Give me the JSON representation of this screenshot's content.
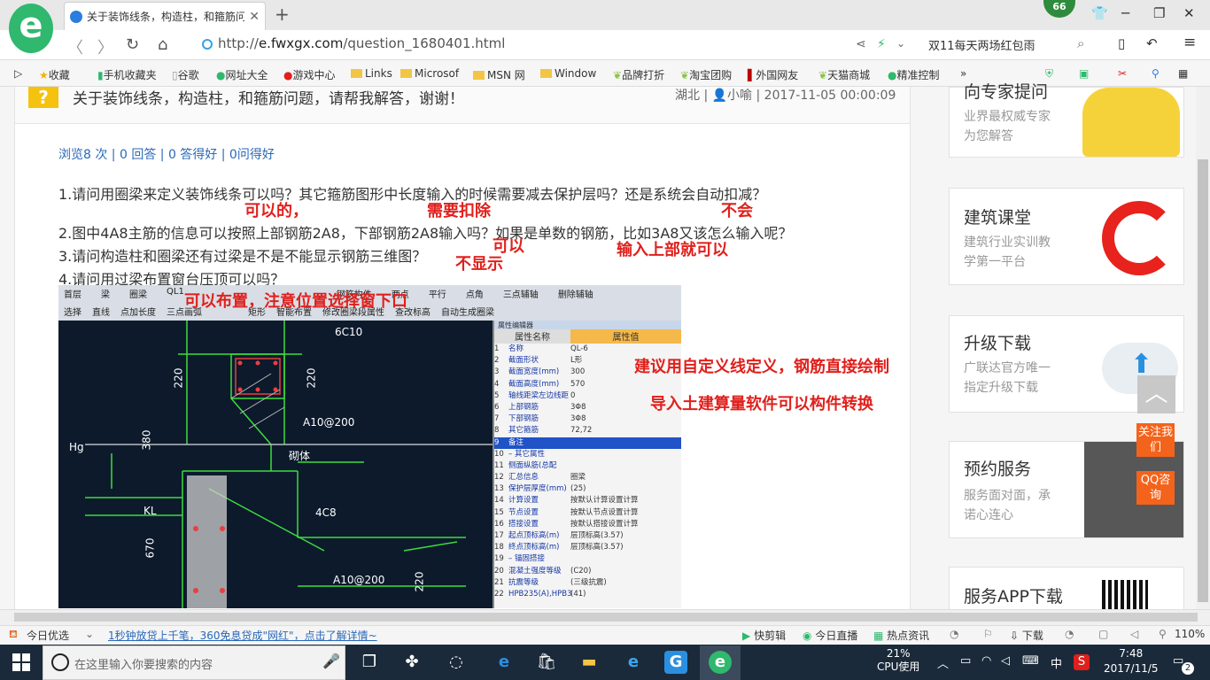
{
  "browser": {
    "tab_title": "关于装饰线条，构造柱，和箍筋问",
    "new_tab": "+",
    "badge": "66",
    "url_prefix": "http://",
    "url_domain": "e.fwxgx.com",
    "url_path": "/question_1680401.html",
    "search_text": "双11每天两场红包雨",
    "zoom": "110%"
  },
  "bookmarks": [
    "收藏",
    "手机收藏夹",
    "谷歌",
    "网址大全",
    "游戏中心",
    "Links",
    "Microsof",
    "MSN 网",
    "Window",
    "品牌打折",
    "淘宝团购",
    "外国网友",
    "天猫商城",
    "精准控制"
  ],
  "question": {
    "title": "关于装饰线条，构造柱，和箍筋问题，请帮我解答，谢谢！",
    "meta": "湖北 | 👤小喻 | 2017-11-05 00:00:09",
    "stats": "浏览8 次 | 0 回答 | 0 答得好 | 0问得好",
    "lines": [
      "1.请问用圈梁来定义装饰线条可以吗？其它箍筋图形中长度输入的时候需要减去保护层吗？还是系统会自动扣减？",
      "2.图中4A8主筋的信息可以按照上部钢筋2A8，下部钢筋2A8输入吗？如果是单数的钢筋，比如3A8又该怎么输入呢？",
      "3.请问构造柱和圈梁还有过梁是不是不能显示钢筋三维图？",
      "4.请问用过梁布置窗台压顶可以吗？"
    ],
    "annotations": {
      "a1": "可以的，",
      "a2": "需要扣除",
      "a3": "不会",
      "a4": "可以",
      "a5": "输入上部就可以",
      "a6": "不显示",
      "a7": "可以布置，注意位置选择窗下口",
      "a8": "建议用自定义线定义，钢筋直接绘制",
      "a9": "导入土建算量软件可以构件转换"
    }
  },
  "cad": {
    "toolbar": [
      "首层",
      "梁",
      "圈梁",
      "QL1",
      "钢筋构件",
      "两点",
      "平行",
      "点角",
      "三点辅轴",
      "删除辅轴"
    ],
    "toolbar2": [
      "选择",
      "直线",
      "点加长度",
      "三点画弧",
      "矩形",
      "智能布置",
      "修改圈梁段属性",
      "查改标高",
      "自动生成圈梁"
    ],
    "labels": {
      "l1": "6C10",
      "l2": "220",
      "l3": "220",
      "l4": "A10@200",
      "l5": "380",
      "l6": "Hg",
      "l7": "砌体",
      "l8": "KL",
      "l9": "4C8",
      "l10": "670",
      "l11": "A10@200",
      "l12": "220"
    },
    "prop_title": "属性编辑器",
    "prop_header": [
      "属性名称",
      "属性值"
    ],
    "props": [
      {
        "n": "1",
        "k": "名称",
        "v": "QL-6"
      },
      {
        "n": "2",
        "k": "截面形状",
        "v": "L形"
      },
      {
        "n": "3",
        "k": "截面宽度(mm)",
        "v": "300"
      },
      {
        "n": "4",
        "k": "截面高度(mm)",
        "v": "570"
      },
      {
        "n": "5",
        "k": "轴线距梁左边线距",
        "v": "0"
      },
      {
        "n": "6",
        "k": "上部钢筋",
        "v": "3Φ8"
      },
      {
        "n": "7",
        "k": "下部钢筋",
        "v": "3Φ8"
      },
      {
        "n": "8",
        "k": "其它箍筋",
        "v": "72,72"
      },
      {
        "n": "9",
        "k": "备注",
        "v": ""
      },
      {
        "n": "10",
        "k": "– 其它属性",
        "v": ""
      },
      {
        "n": "11",
        "k": "侧面纵筋(总配",
        "v": ""
      },
      {
        "n": "12",
        "k": "汇总信息",
        "v": "圈梁"
      },
      {
        "n": "13",
        "k": "保护层厚度(mm)",
        "v": "(25)"
      },
      {
        "n": "14",
        "k": "计算设置",
        "v": "按默认计算设置计算"
      },
      {
        "n": "15",
        "k": "节点设置",
        "v": "按默认节点设置计算"
      },
      {
        "n": "16",
        "k": "搭接设置",
        "v": "按默认搭接设置计算"
      },
      {
        "n": "17",
        "k": "起点顶标高(m)",
        "v": "层顶标高(3.57)"
      },
      {
        "n": "18",
        "k": "终点顶标高(m)",
        "v": "层顶标高(3.57)"
      },
      {
        "n": "19",
        "k": "– 锚固搭接",
        "v": ""
      },
      {
        "n": "20",
        "k": "混凝土强度等级",
        "v": "(C20)"
      },
      {
        "n": "21",
        "k": "抗震等级",
        "v": "(三级抗震)"
      },
      {
        "n": "22",
        "k": "HPB235(A),HPB3",
        "v": "(41)"
      }
    ]
  },
  "sidebar": [
    {
      "title": "向专家提问",
      "sub1": "业界最权威专家",
      "sub2": "为您解答"
    },
    {
      "title": "建筑课堂",
      "sub1": "建筑行业实训教",
      "sub2": "学第一平台"
    },
    {
      "title": "升级下载",
      "sub1": "广联达官方唯一",
      "sub2": "指定升级下载"
    },
    {
      "title": "预约服务",
      "sub1": "服务面对面，承",
      "sub2": "诺心连心"
    },
    {
      "title": "服务APP下载",
      "sub1": "",
      "sub2": ""
    }
  ],
  "float": {
    "follow": "关注我们",
    "qq": "QQ咨询",
    "top": "︿"
  },
  "statusbar": {
    "left": "今日优选",
    "news": "1秒钟放贷上千笔，360免息贷成\"网红\"，点击了解详情~",
    "items": [
      "快剪辑",
      "今日直播",
      "热点资讯",
      "下载"
    ],
    "zoom": "110%"
  },
  "taskbar": {
    "search_placeholder": "在这里输入你要搜索的内容",
    "cpu_pct": "21%",
    "cpu_label": "CPU使用",
    "ime": "中",
    "time": "7:48",
    "date": "2017/11/5",
    "notif": "2"
  }
}
